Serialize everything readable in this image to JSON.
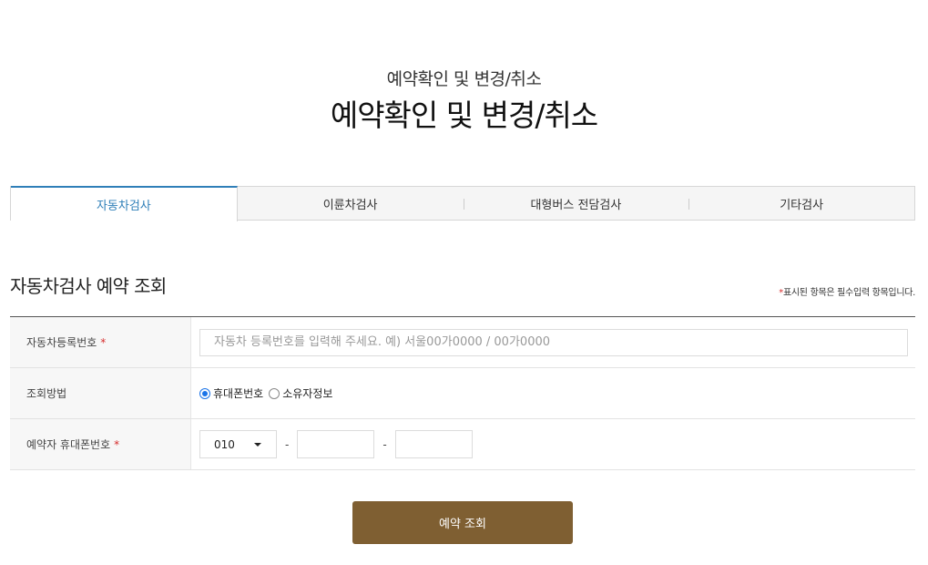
{
  "header": {
    "subtitle": "예약확인 및 변경/취소",
    "title": "예약확인 및 변경/취소"
  },
  "tabs": [
    {
      "label": "자동차검사",
      "active": true
    },
    {
      "label": "이륜차검사",
      "active": false
    },
    {
      "label": "대형버스 전담검사",
      "active": false
    },
    {
      "label": "기타검사",
      "active": false
    }
  ],
  "section": {
    "title": "자동차검사 예약 조회",
    "required_star": "*",
    "required_note": "표시된 항목은 필수입력 항목입니다."
  },
  "form": {
    "vehicle_number": {
      "label": "자동차등록번호",
      "star": "*",
      "placeholder": "자동차 등록번호를 입력해 주세요. 예) 서울00가0000 / 00가0000"
    },
    "search_method": {
      "label": "조회방법",
      "options": [
        {
          "label": "휴대폰번호",
          "checked": true
        },
        {
          "label": "소유자정보",
          "checked": false
        }
      ]
    },
    "phone": {
      "label": "예약자 휴대폰번호",
      "star": "*",
      "prefix": "010",
      "dash": "-"
    }
  },
  "actions": {
    "submit_label": "예약 조회"
  },
  "colors": {
    "accent_tab": "#2f7fb8",
    "submit_button": "#7f5f32",
    "required_star": "#d62d2d"
  }
}
